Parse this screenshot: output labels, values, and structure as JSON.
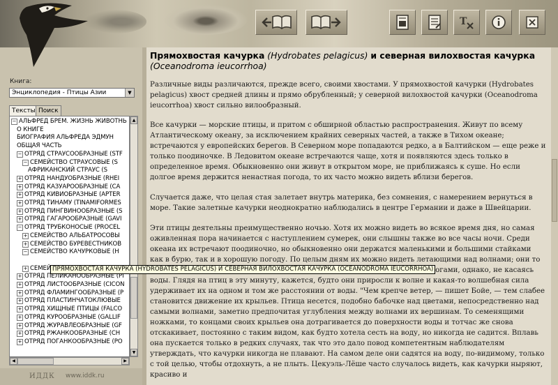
{
  "book": {
    "label": "Книга:",
    "selected": "Энциклопедия - Птицы Азии"
  },
  "tabs": [
    {
      "label": "Тексты",
      "active": true
    },
    {
      "label": "Поиск",
      "active": false
    }
  ],
  "tree": [
    {
      "box": "−",
      "level": 0,
      "label": "АЛЬФРЕД БРЕМ. ЖИЗНЬ ЖИВОТНЬ"
    },
    {
      "box": "",
      "level": 1,
      "label": "О КНИГЕ"
    },
    {
      "box": "",
      "level": 1,
      "label": "БИОГРАФИЯ АЛЬФРЕДА ЭДМУН"
    },
    {
      "box": "",
      "level": 1,
      "label": "ОБЩАЯ ЧАСТЬ"
    },
    {
      "box": "−",
      "level": 1,
      "label": "ОТРЯД СТРАУСООБРАЗНЫЕ (STF"
    },
    {
      "box": "−",
      "level": 2,
      "label": "СЕМЕЙСТВО СТРАУСОВЫЕ (S"
    },
    {
      "box": "",
      "level": 3,
      "label": "АФРИКАНСКИЙ СТРАУС (S"
    },
    {
      "box": "+",
      "level": 1,
      "label": "ОТРЯД НАНДУОБРАЗНЫЕ (RHEI"
    },
    {
      "box": "+",
      "level": 1,
      "label": "ОТРЯД КАЗУАРООБРАЗНЫЕ (CA"
    },
    {
      "box": "+",
      "level": 1,
      "label": "ОТРЯД КИВИОБРАЗНЫЕ (APTER"
    },
    {
      "box": "+",
      "level": 1,
      "label": "ОТРЯД ТИНАМУ (TINAMIFORMES"
    },
    {
      "box": "+",
      "level": 1,
      "label": "ОТРЯД ПИНГВИНООБРАЗНЫЕ (S"
    },
    {
      "box": "+",
      "level": 1,
      "label": "ОТРЯД ГАГАРООБРАЗНЫЕ (GAVI"
    },
    {
      "box": "−",
      "level": 1,
      "label": "ОТРЯД ТРУБКОНОСЫЕ (PROCEL"
    },
    {
      "box": "+",
      "level": 2,
      "label": "СЕМЕЙСТВО АЛЬБАТРОСОВЫ"
    },
    {
      "box": "+",
      "level": 2,
      "label": "СЕМЕЙСТВО БУРЕВЕСТНИКОВ"
    },
    {
      "box": "−",
      "level": 2,
      "label": "СЕМЕЙСТВО КАЧУРКОВЫЕ (H"
    },
    {
      "box": "",
      "level": 3,
      "label": ""
    },
    {
      "box": "+",
      "level": 2,
      "label": "СЕМЕЙСТВО НЫРЯЮЩИЕ БУРЕ"
    },
    {
      "box": "+",
      "level": 1,
      "label": "ОТРЯД ПЕЛИКАНООБРАЗНЫЕ (PI"
    },
    {
      "box": "+",
      "level": 1,
      "label": "ОТРЯД ЛИСТООБРАЗНЫЕ (CICON"
    },
    {
      "box": "+",
      "level": 1,
      "label": "ОТРЯД ФЛАМИНГООБРАЗНЫЕ (P"
    },
    {
      "box": "+",
      "level": 1,
      "label": "ОТРЯД ПЛАСТИНЧАТОКЛЮВЫЕ"
    },
    {
      "box": "+",
      "level": 1,
      "label": "ОТРЯД ХИЩНЫЕ ПТИЦЫ (FALCO"
    },
    {
      "box": "+",
      "level": 1,
      "label": "ОТРЯД КУРООБРАЗНЫЕ (GALLIF"
    },
    {
      "box": "+",
      "level": 1,
      "label": "ОТРЯД ЖУРАВЛЕОБРАЗНЫЕ (GF"
    },
    {
      "box": "+",
      "level": 1,
      "label": "ОТРЯД РЖАНКООБРАЗНЫЕ (CH"
    },
    {
      "box": "+",
      "level": 1,
      "label": "ОТРЯД ПОГАНКООБРАЗНЫЕ (PO"
    }
  ],
  "tooltip": "ПРЯМОХВОСТАЯ КАЧУРКА (HYDROBATES PELAGICUS) И СЕВЕРНАЯ ВИЛОХВОСТАЯ КАЧУРКА (OCEANODROMA IEUCORRHOA)",
  "footer": {
    "left": "ИДДК",
    "right": "www.iddk.ru"
  },
  "article": {
    "title_bold_1": "Прямохвостая качурка",
    "title_latin_1": "(Hydrobates pelagicus)",
    "title_bold_2": "и северная вилохвостая качурка",
    "title_latin_2": "(Oceanodroma ieucorrhoa)",
    "paragraphs": [
      "Различные виды различаются, прежде всего, своими хвостами. У прямохвостой качурки (Hydrobates pelagicus) хвост средней длины и прямо обрубленный; у северной вилохвостой качурки (Oceanodroma ieucorrhoa) хвост сильно вилообразный.",
      "Все качурки — морские птицы, и притом с обширной областью распространения. Живут по всему Атлантическому океану, за исключением крайних северных частей, а также в Тихом океане; встречаются у европейских берегов. В Северном море попадаются редко, а в Балтийском — еще реже и только поодиночке. В Ледовитом океане встречаются чаще, хотя и появляются здесь только в определенное время. Обыкновенно они живут в открытом море, не приближаясь к суше. Но если долгое время держится ненастная погода, то их часто можно видеть вблизи берегов.",
      "Случается даже, что целая стая залетает внутрь материка, без сомнения, с намерением вернуться в море. Такие залетные качурки неоднократно наблюдались в центре Германии и даже в Швейцарии.",
      "Эти птицы деятельны преимущественно ночью. Хотя их можно видеть во всякое время дня, но самая оживленная пора начинается с наступлением сумерек, они слышны также во все часы ночи. Среди океана их встречают поодиночно, но обыкновенно они держатся маленькими и большими стайками как в бурю, так и в хорошую погоду. По целым дням их можно видеть летающими над волнами; они то поднимаются, то опускаются вдоль волн, все время не переставая летать ногами, однако, не касаясь воды. Глядя на птиц в эту минуту, кажется, будто они приросли к волне и какая-то волшебная сила удерживает их на одном и том же расстоянии от воды. \"Чем крепче ветер, — пишет Бойе, — тем слабее становится движение их крыльев. Птица несется, подобно бабочке над цветами, непосредственно над самыми волнами, заметно предпочитая углубления между волнами их вершинам. То семенящими ножками, то концами своих крыльев она дотрагивается до поверхности воды и тотчас же снова отскакивает, постоянно с таким видом, как будто хотела сесть на воду, но никогда не садится. Вплавь она пускается только в редких случаях, так что это дало повод компетентным наблюдателям утверждать, что качурки никогда не плавают. На самом деле они садятся на воду, по-видимому, только с той целью, чтобы отдохнуть, а не плыть. Цекуэль-Лёше часто случалось видеть, как качурки ныряют, красиво и"
    ]
  }
}
